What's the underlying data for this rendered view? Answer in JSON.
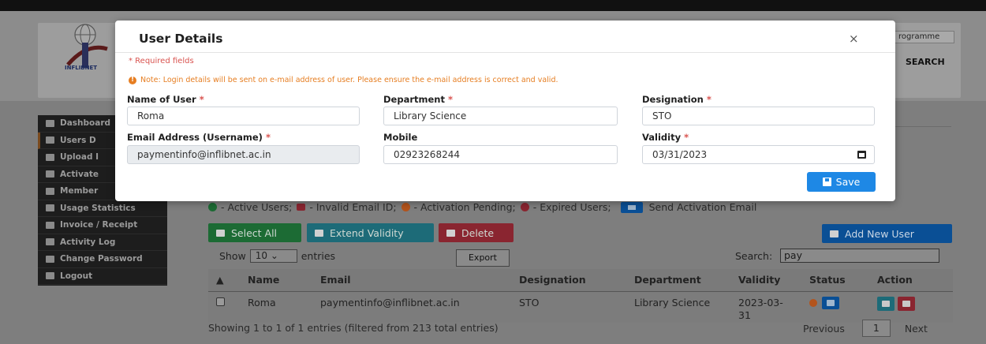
{
  "header": {
    "logo_text": "INFLIBNET",
    "programme_field": "rogramme",
    "search_link": "SEARCH"
  },
  "sidebar": {
    "items": [
      {
        "label": "Dashboard",
        "icon": "dashboard-icon"
      },
      {
        "label": "Users D",
        "icon": "users-icon"
      },
      {
        "label": "Upload I",
        "icon": "upload-icon"
      },
      {
        "label": "Activate",
        "icon": "activate-icon"
      },
      {
        "label": "Member",
        "icon": "member-icon"
      },
      {
        "label": "Usage Statistics",
        "icon": "chart-icon"
      },
      {
        "label": "Invoice / Receipt",
        "icon": "invoice-icon"
      },
      {
        "label": "Activity Log",
        "icon": "list-icon"
      },
      {
        "label": "Change Password",
        "icon": "key-icon"
      },
      {
        "label": "Logout",
        "icon": "logout-icon"
      }
    ]
  },
  "legend": {
    "active": "- Active Users;",
    "invalid": "- Invalid Email ID;",
    "pending": "- Activation Pending;",
    "expired": "- Expired Users;",
    "send": "Send Activation Email",
    "colors": {
      "active": "#1c6b34",
      "invalid": "#8a2530",
      "pending": "#b3541c",
      "expired": "#8a2530",
      "send": "#0a4f95"
    }
  },
  "toolbar": {
    "select_all": "Select All",
    "extend_validity": "Extend Validity",
    "delete": "Delete",
    "add_new_user": "Add New User"
  },
  "table_controls": {
    "show": "Show",
    "page_size": "10",
    "entries": "entries",
    "export": "Export",
    "search_label": "Search:",
    "search_value": "pay"
  },
  "table": {
    "columns": [
      "Name",
      "Email",
      "Designation",
      "Department",
      "Validity",
      "Status",
      "Action"
    ],
    "rows": [
      {
        "name": "Roma",
        "email": "paymentinfo@inflibnet.ac.in",
        "designation": "STO",
        "department": "Library Science",
        "validity": "2023-03-31"
      }
    ]
  },
  "footer": {
    "info": "Showing 1 to 1 of 1 entries (filtered from 213 total entries)",
    "previous": "Previous",
    "page": "1",
    "next": "Next"
  },
  "modal": {
    "title": "User Details",
    "close": "×",
    "required_note": "* Required fields",
    "note": "Note: Login details will be sent on e-mail address of user. Please ensure the e-mail address is correct and valid.",
    "fields": {
      "name_label": "Name of User",
      "name_value": "Roma",
      "department_label": "Department",
      "department_value": "Library Science",
      "designation_label": "Designation",
      "designation_value": "STO",
      "email_label": "Email Address (Username)",
      "email_value": "paymentinfo@inflibnet.ac.in",
      "mobile_label": "Mobile",
      "mobile_value": "02923268244",
      "validity_label": "Validity",
      "validity_value": "03/31/2023",
      "required_star": "*"
    },
    "save": "Save"
  }
}
